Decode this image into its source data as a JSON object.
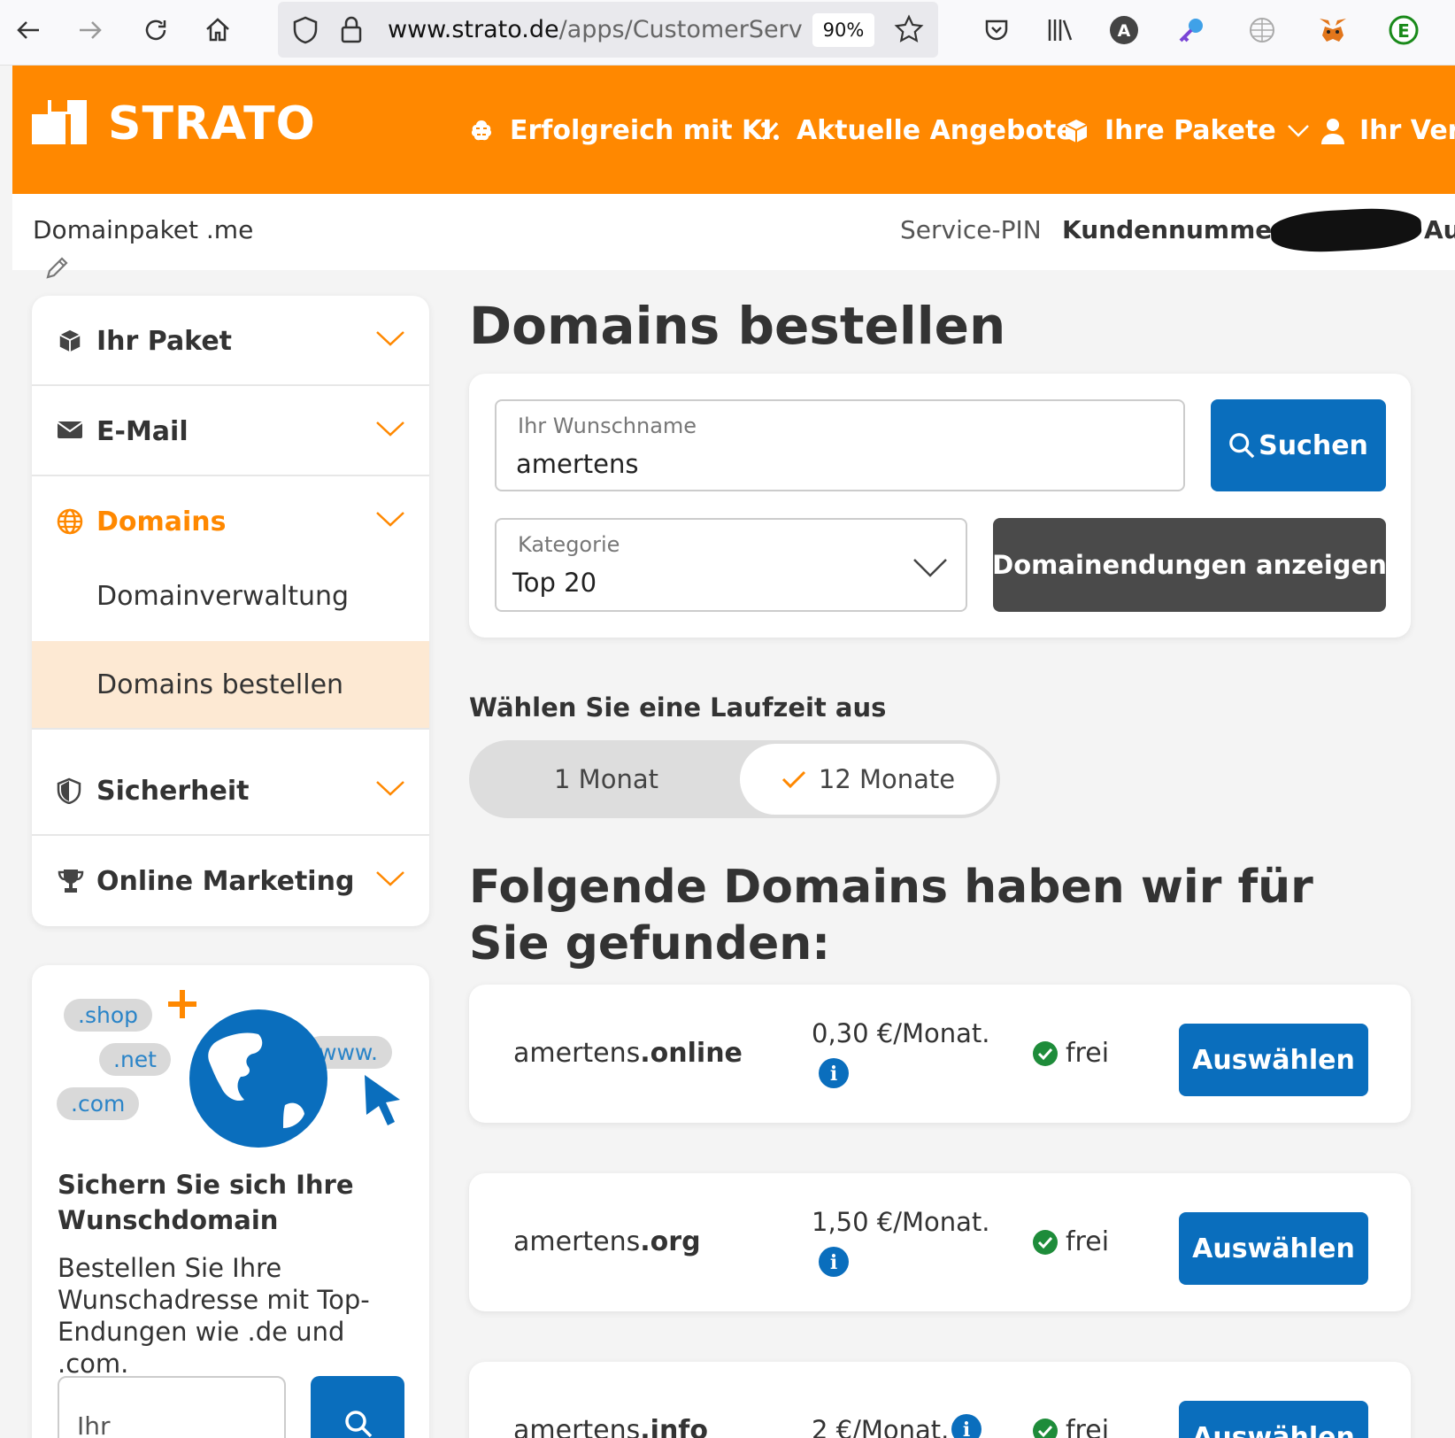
{
  "browser": {
    "url_domain": "www.strato.de",
    "url_path": "/apps/CustomerService?",
    "zoom": "90%",
    "icons": [
      "back-icon",
      "forward-icon",
      "reload-icon",
      "home-icon",
      "shield-icon",
      "lock-icon",
      "star-icon",
      "pocket-icon",
      "library-icon",
      "account-icon",
      "extension-key-icon",
      "extension-globe-icon",
      "metamask-icon",
      "extension-e-icon"
    ]
  },
  "header": {
    "logo": "STRATO",
    "nav": [
      {
        "label": "Erfolgreich mit KI",
        "icon": "brain-icon"
      },
      {
        "label": "Aktuelle Angebote",
        "icon": "percent-icon"
      },
      {
        "label": "Ihre Pakete",
        "icon": "box-icon"
      },
      {
        "label": "Ihr Vert",
        "icon": "user-icon"
      }
    ],
    "brand_color": "#ff8800"
  },
  "subbar": {
    "package": "Domainpaket .me",
    "service_pin": "Service-PIN",
    "customer_number": "Kundennummer",
    "auf": "Auf"
  },
  "sidebar": {
    "items": [
      {
        "label": "Ihr Paket",
        "icon": "box-icon"
      },
      {
        "label": "E-Mail",
        "icon": "envelope-icon"
      },
      {
        "label": "Domains",
        "icon": "globe-icon"
      },
      {
        "label": "Sicherheit",
        "icon": "shield-icon"
      },
      {
        "label": "Online Marketing",
        "icon": "trophy-icon"
      }
    ],
    "sub_items": [
      "Domainverwaltung",
      "Domains bestellen"
    ],
    "accent_color": "#ff8800",
    "active_bg": "#fde9d3"
  },
  "promo": {
    "bubbles": [
      ".shop",
      ".net",
      ".com",
      "www."
    ],
    "title": "Sichern Sie sich Ihre Wunschdomain",
    "text": "Bestellen Sie Ihre Wunschadresse mit Top-Endungen wie .de und .com.",
    "input_placeholder": "Ihr Wunschna..."
  },
  "main": {
    "title": "Domains bestellen",
    "search_label": "Ihr Wunschname",
    "search_value": "amertens",
    "search_button": "Suchen",
    "category_label": "Kategorie",
    "category_value": "Top 20",
    "show_endings_button": "Domainendungen anzeigen",
    "term_title": "Wählen Sie eine Laufzeit aus",
    "term_options": [
      "1 Monat",
      "12 Monate"
    ],
    "term_selected": "12 Monate",
    "results_title": "Folgende Domains haben wir für Sie gefunden:",
    "results": [
      {
        "name": "amertens",
        "tld": ".online",
        "price": "0,30 €/Monat.",
        "status": "frei",
        "button": "Auswählen"
      },
      {
        "name": "amertens",
        "tld": ".org",
        "price": "1,50 €/Monat.",
        "status": "frei",
        "button": "Auswählen"
      },
      {
        "name": "amertens",
        "tld": ".info",
        "price": "2 €/Monat.",
        "status": "frei",
        "button": "Auswählen"
      }
    ],
    "button_color": "#0a6ebd"
  }
}
